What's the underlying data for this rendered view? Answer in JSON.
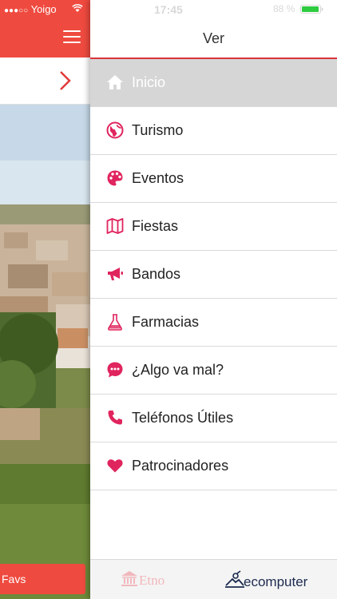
{
  "status_bar": {
    "signal_dots": "●●●○○",
    "carrier": "Yoigo",
    "time": "17:45",
    "battery": "88 %"
  },
  "drawer": {
    "title": "Ver",
    "items": [
      {
        "label": "Inicio",
        "icon": "home-icon",
        "active": true
      },
      {
        "label": "Turismo",
        "icon": "globe-icon",
        "active": false
      },
      {
        "label": "Eventos",
        "icon": "palette-icon",
        "active": false
      },
      {
        "label": "Fiestas",
        "icon": "map-icon",
        "active": false
      },
      {
        "label": "Bandos",
        "icon": "megaphone-icon",
        "active": false
      },
      {
        "label": "Farmacias",
        "icon": "flask-icon",
        "active": false
      },
      {
        "label": "¿Algo va mal?",
        "icon": "chat-bubble-icon",
        "active": false
      },
      {
        "label": "Teléfonos Útiles",
        "icon": "phone-icon",
        "active": false
      },
      {
        "label": "Patrocinadores",
        "icon": "heart-icon",
        "active": false
      }
    ],
    "footer": {
      "etno_logo_text": "Etno",
      "ecomputer_logo_text": "ecomputer"
    }
  },
  "background_app": {
    "favs_label": "Favs"
  },
  "colors": {
    "accent_red": "#ef4a3f",
    "icon_crimson": "#e0245e",
    "active_row_bg": "#d6d6d6"
  }
}
